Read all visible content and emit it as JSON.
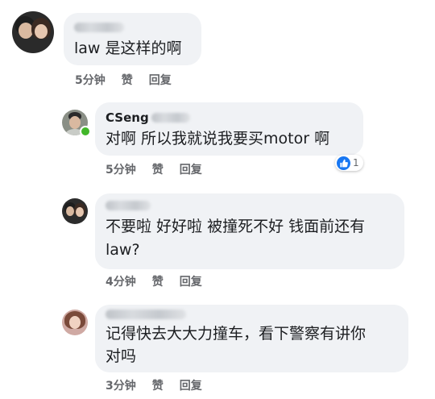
{
  "comments": [
    {
      "name": "",
      "text_lines": [
        "law 是这样的啊"
      ],
      "time": "5分钟",
      "like_label": "赞",
      "reply_label": "回复"
    },
    {
      "name": "CSeng",
      "text_lines": [
        "对啊 所以我就说我要买motor 啊"
      ],
      "time": "5分钟",
      "like_label": "赞",
      "reply_label": "回复",
      "reaction_count": "1",
      "online": true
    },
    {
      "name": "",
      "text_lines": [
        "不要啦 好好啦 被撞死不好 钱面前还有",
        "law?"
      ],
      "time": "4分钟",
      "like_label": "赞",
      "reply_label": "回复"
    },
    {
      "name": "",
      "text_lines": [
        "记得快去大大力撞车，看下警察有讲你",
        "对吗"
      ],
      "time": "3分钟",
      "like_label": "赞",
      "reply_label": "回复"
    }
  ],
  "colors": {
    "bubble": "#f0f2f5",
    "meta_text": "#65676b",
    "like_blue": "#1877f2",
    "online_green": "#42b72a"
  },
  "icons": {
    "reaction": "thumbs-up-icon"
  }
}
